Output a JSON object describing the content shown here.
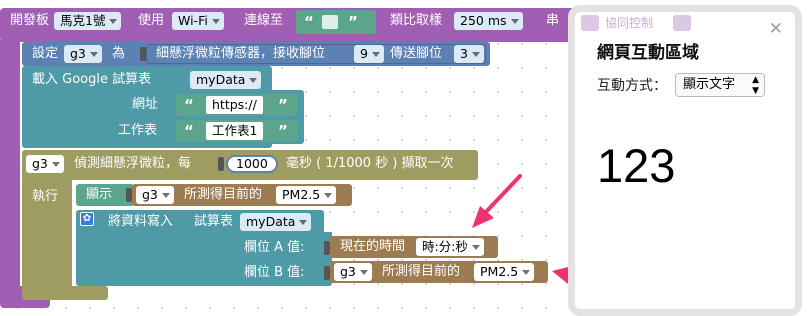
{
  "colors": {
    "board_purple": "#a15fb3",
    "sensor_blue": "#5c81b3",
    "sheet_teal": "#4e9aa6",
    "loop_olive": "#9e9c61",
    "display_brown": "#9e7c52",
    "text_block_green": "#5ba58c",
    "arrow_red": "#f0336e"
  },
  "board_block": {
    "label_board": "開發板",
    "board_value": "馬克1號",
    "label_use": "使用",
    "conn_value": "Wi-Fi",
    "label_connect_to": "連線至",
    "quote_open": "“",
    "quote_close": "”",
    "label_analog_sampling": "類比取樣",
    "sampling_value": "250 ms",
    "label_serial": "串",
    "collab_label": "協同控制"
  },
  "sensor_block": {
    "label_set": "設定",
    "var_value": "g3",
    "label_as": "為",
    "sensor_text": "細懸浮微粒傳感器，接收腳位",
    "rx_pin": "9",
    "label_tx": "傳送腳位",
    "tx_pin": "3"
  },
  "sheet_block": {
    "label_load": "載入 Google 試算表",
    "sheet_var": "myData",
    "label_url": "網址",
    "url_value": "https://",
    "label_worksheet": "工作表",
    "worksheet_value": "工作表1"
  },
  "loop_block": {
    "var_value": "g3",
    "label_detect": "偵測細懸浮微粒，每",
    "interval_value": "1000",
    "label_ms": "毫秒 ( 1/1000 秒 ) 擷取一次",
    "label_execute": "執行"
  },
  "display_block": {
    "label_display": "顯示",
    "var_value": "g3",
    "label_measured": "所測得目前的",
    "measure_value": "PM2.5"
  },
  "write_block": {
    "label_write": "將資料寫入",
    "label_sheet": "試算表",
    "sheet_var": "myData",
    "label_field_a": "欄位 A 值:",
    "time_label": "現在的時間",
    "time_format": "時:分:秒",
    "label_field_b": "欄位 B 值:",
    "field_b_var": "g3",
    "field_b_label": "所測得目前的",
    "field_b_measure": "PM2.5"
  },
  "panel": {
    "close_symbol": "✕",
    "title": "網頁互動區域",
    "mode_label": "互動方式：",
    "mode_value": "顯示文字",
    "display_text": "123"
  }
}
